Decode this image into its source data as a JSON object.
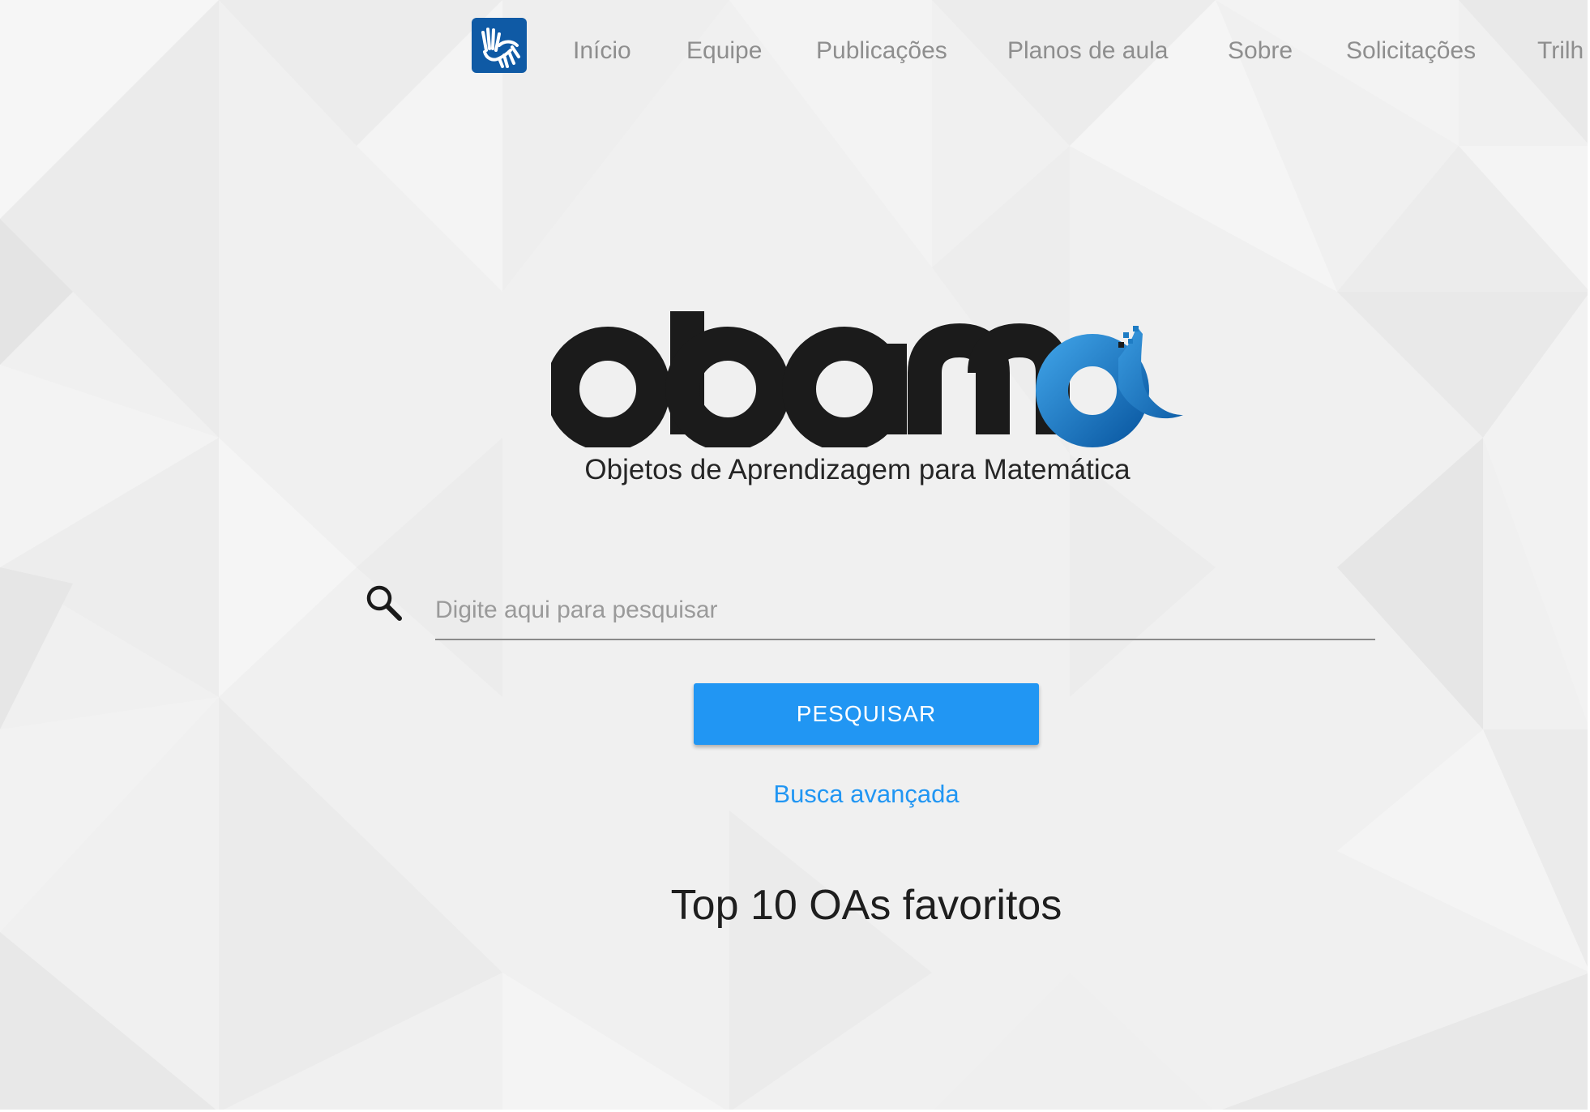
{
  "nav": {
    "items": [
      {
        "label": "Início"
      },
      {
        "label": "Equipe"
      },
      {
        "label": "Publicações"
      },
      {
        "label": "Planos de aula"
      },
      {
        "label": "Sobre"
      },
      {
        "label": "Solicitações"
      },
      {
        "label": "Trilh"
      }
    ],
    "icon": "sign-language-hands-icon"
  },
  "logo": {
    "text": "obama",
    "subtitle": "Objetos de Aprendizagem para Matemática"
  },
  "search": {
    "placeholder": "Digite aqui para pesquisar",
    "value": "",
    "button_label": "PESQUISAR",
    "advanced_link": "Busca avançada"
  },
  "section": {
    "title": "Top 10 OAs favoritos"
  },
  "colors": {
    "primary": "#2196f3",
    "logo_blue": "#1e7cc4",
    "icon_bg": "#0f5aa5",
    "text_dark": "#1b1b1b",
    "nav_text": "#8e8e8e"
  }
}
